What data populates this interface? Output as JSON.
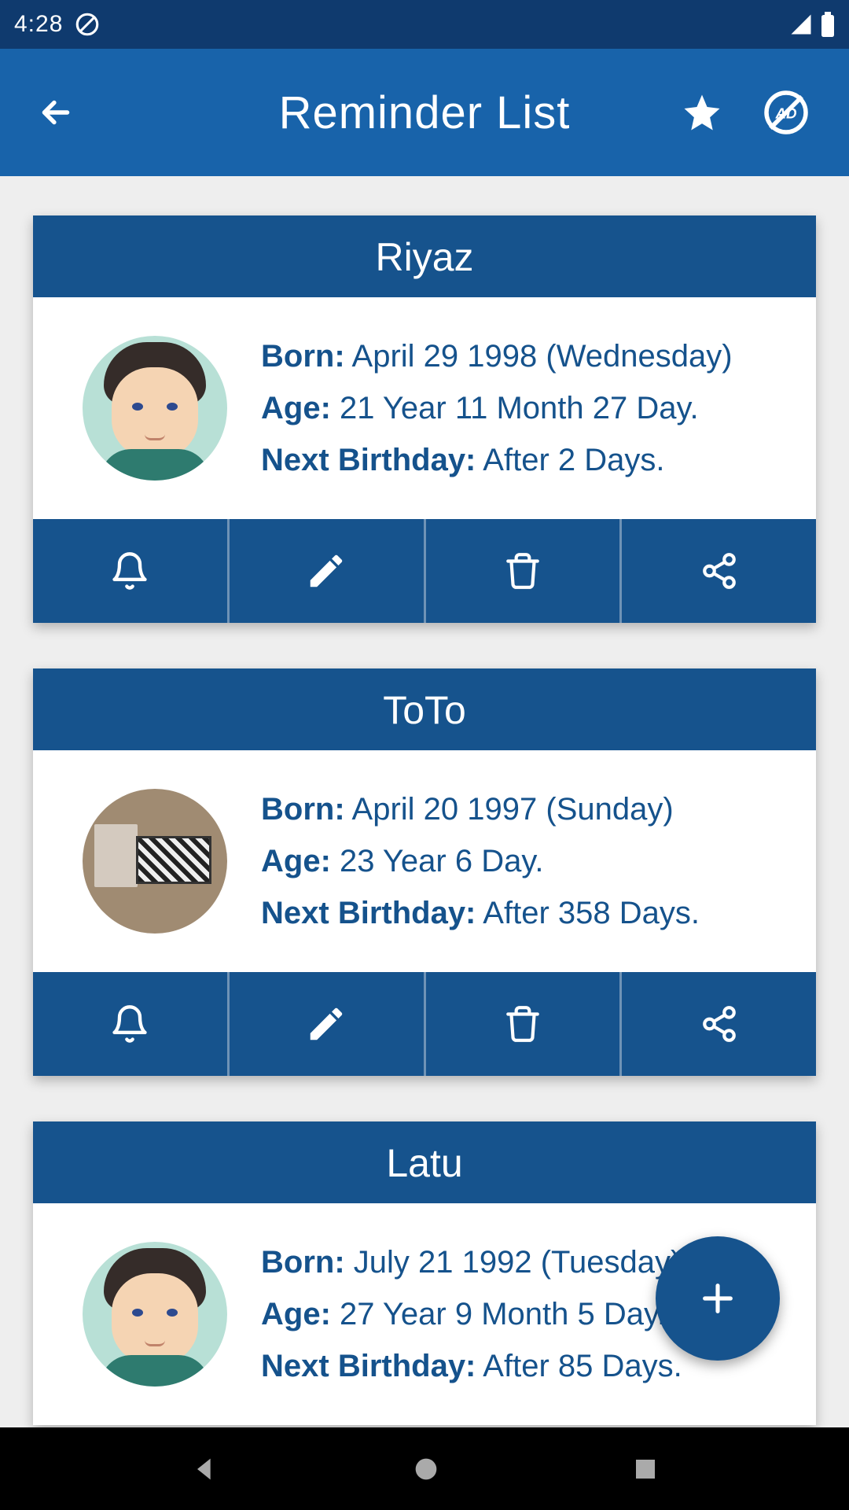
{
  "status": {
    "time": "4:28"
  },
  "header": {
    "title": "Reminder List"
  },
  "labels": {
    "born": "Born:",
    "age": "Age:",
    "next": "Next Birthday:"
  },
  "reminders": [
    {
      "name": "Riyaz",
      "avatar_type": "male",
      "born": "April 29 1998 (Wednesday)",
      "age": "21 Year 11 Month 27 Day.",
      "next": "After 2 Days."
    },
    {
      "name": "ToTo",
      "avatar_type": "room",
      "born": "April 20 1997 (Sunday)",
      "age": "23 Year 6 Day.",
      "next": "After 358 Days."
    },
    {
      "name": "Latu",
      "avatar_type": "male",
      "born": "July 21 1992 (Tuesday)",
      "age": "27 Year 9 Month 5 Day.",
      "next": "After 85 Days."
    }
  ]
}
